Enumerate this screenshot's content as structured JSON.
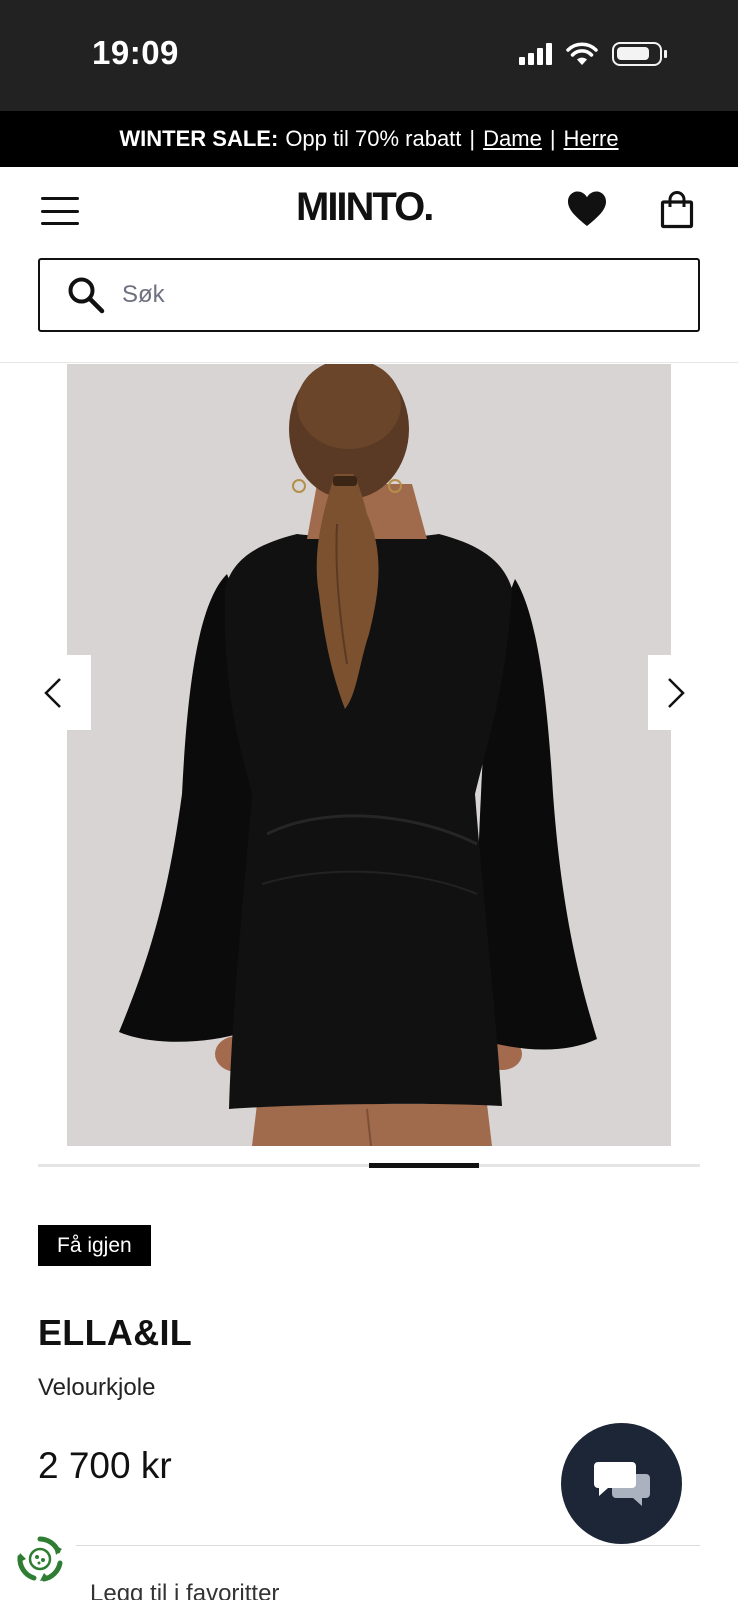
{
  "status_bar": {
    "time": "19:09",
    "icons": [
      "cellular-signal-icon",
      "wifi-icon",
      "battery-icon"
    ]
  },
  "promo_banner": {
    "bold_text": "WINTER SALE:",
    "text": "Opp til 70% rabatt",
    "separator": "|",
    "links": [
      "Dame",
      "Herre"
    ]
  },
  "header": {
    "logo": "MIINTO.",
    "icons": [
      "menu-icon",
      "heart-icon",
      "shopping-bag-icon"
    ]
  },
  "search": {
    "placeholder": "Søk",
    "value": ""
  },
  "gallery": {
    "slide_count": 6,
    "current_slide": 4,
    "nav": [
      "chevron-left-icon",
      "chevron-right-icon"
    ]
  },
  "product": {
    "badge": "Få igjen",
    "brand": "ELLA&IL",
    "name": "Velourkjole",
    "price": "2 700 kr"
  },
  "actions": {
    "favorites_label": "Legg til i favoritter"
  },
  "colors": {
    "status_bar_bg": "#222222",
    "banner_bg": "#000000",
    "chat_button_bg": "#1d2637",
    "eco_green": "#2e7d32"
  }
}
